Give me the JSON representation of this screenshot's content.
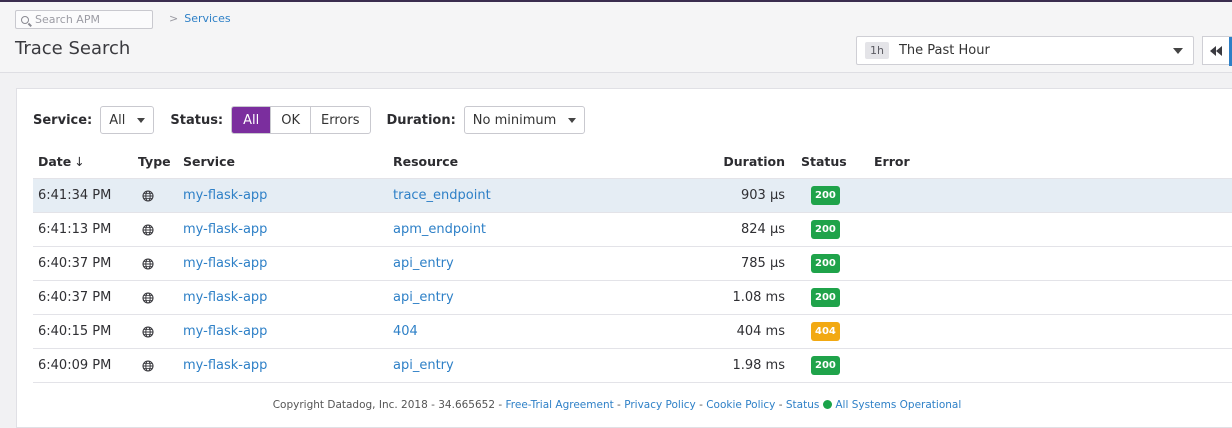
{
  "search": {
    "placeholder": "Search APM"
  },
  "breadcrumb": {
    "sep": ">",
    "item": "Services"
  },
  "page_title": "Trace Search",
  "time_picker": {
    "badge": "1h",
    "label": "The Past Hour"
  },
  "filters": {
    "service_label": "Service:",
    "service_value": "All",
    "status_label": "Status:",
    "status_options": [
      "All",
      "OK",
      "Errors"
    ],
    "status_selected": "All",
    "duration_label": "Duration:",
    "duration_value": "No minimum"
  },
  "table": {
    "headers": {
      "date": "Date",
      "date_sort": "↓",
      "type": "Type",
      "service": "Service",
      "resource": "Resource",
      "duration": "Duration",
      "status": "Status",
      "error": "Error"
    },
    "rows": [
      {
        "date": "6:41:34 PM",
        "type": "globe-icon",
        "service": "my-flask-app",
        "resource": "trace_endpoint",
        "duration": "903 μs",
        "status": "200",
        "error": ""
      },
      {
        "date": "6:41:13 PM",
        "type": "globe-icon",
        "service": "my-flask-app",
        "resource": "apm_endpoint",
        "duration": "824 μs",
        "status": "200",
        "error": ""
      },
      {
        "date": "6:40:37 PM",
        "type": "globe-icon",
        "service": "my-flask-app",
        "resource": "api_entry",
        "duration": "785 μs",
        "status": "200",
        "error": ""
      },
      {
        "date": "6:40:37 PM",
        "type": "globe-icon",
        "service": "my-flask-app",
        "resource": "api_entry",
        "duration": "1.08 ms",
        "status": "200",
        "error": ""
      },
      {
        "date": "6:40:15 PM",
        "type": "globe-icon",
        "service": "my-flask-app",
        "resource": "404",
        "duration": "404 ms",
        "status": "404",
        "error": ""
      },
      {
        "date": "6:40:09 PM",
        "type": "globe-icon",
        "service": "my-flask-app",
        "resource": "api_entry",
        "duration": "1.98 ms",
        "status": "200",
        "error": ""
      }
    ]
  },
  "footer": {
    "copyright": "Copyright Datadog, Inc. 2018 - 34.665652 - ",
    "link_trial": "Free-Trial Agreement",
    "dash": " - ",
    "link_privacy": "Privacy Policy",
    "link_cookie": "Cookie Policy",
    "link_status": "Status",
    "systems": "All Systems Operational"
  },
  "colors": {
    "accent_purple": "#7b2e9e",
    "link_blue": "#2e80c7",
    "status_ok": "#1fa34a",
    "status_warn": "#f2a912"
  }
}
